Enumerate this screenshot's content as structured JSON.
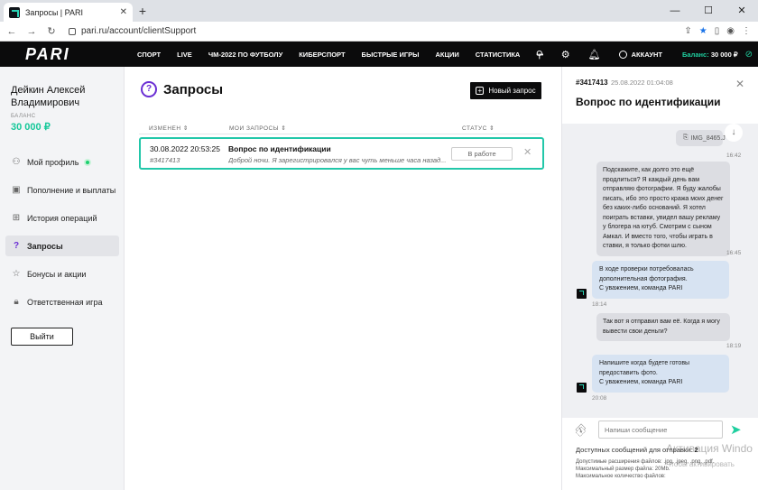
{
  "browser": {
    "tab_title": "Запросы | PARI",
    "url": "pari.ru/account/clientSupport"
  },
  "header": {
    "logo": "PARI",
    "nav": [
      "СПОРТ",
      "LIVE",
      "ЧМ-2022 ПО ФУТБОЛУ",
      "КИБЕРСПОРТ",
      "БЫСТРЫЕ ИГРЫ",
      "АКЦИИ",
      "СТАТИСТИКА",
      "•••"
    ],
    "account_label": "АККАУНТ",
    "balance_label": "Баланс:",
    "balance_value": "30 000 ₽"
  },
  "sidebar": {
    "user_name": "Дейкин Алексей Владимирович",
    "balance_label": "БАЛАНС",
    "balance_value": "30 000 ₽",
    "items": [
      {
        "label": "Мой профиль",
        "icon": "user-icon"
      },
      {
        "label": "Пополнение и выплаты",
        "icon": "wallet-icon"
      },
      {
        "label": "История операций",
        "icon": "grid-icon"
      },
      {
        "label": "Запросы",
        "icon": "question-icon"
      },
      {
        "label": "Бонусы и акции",
        "icon": "star-icon"
      },
      {
        "label": "Ответственная игра",
        "icon": "lock-icon"
      }
    ],
    "logout": "Выйти"
  },
  "main": {
    "title": "Запросы",
    "new_request": "Новый запрос",
    "columns": {
      "changed": "ИЗМЕНЕН",
      "my_requests": "МОИ ЗАПРОСЫ",
      "status": "СТАТУС"
    },
    "request": {
      "date": "30.08.2022 20:53:25",
      "id": "#3417413",
      "subject": "Вопрос по идентификации",
      "preview": "Доброй ночи. Я зарегистрировался у вас чуть меньше часа назад...",
      "status": "В работе"
    }
  },
  "chat": {
    "id": "#3417413",
    "datetime": "25.08.2022 01:04:08",
    "title": "Вопрос по идентификации",
    "attachment": "IMG_8465.J",
    "attachment_time": "16:42",
    "msg1": "Подскажите, как долго это ещё продлиться? Я каждый день вам отправляю фотографии. Я буду жалобы писать, ибо это просто кража моих денег без каких-либо оснований. Я хотел поиграть вставки, увидел вашу рекламу у блогера на ютуб. Смотрим с сыном Амкал. И вместо того, чтобы играть в ставки, я только фотки шлю.",
    "msg1_time": "16:45",
    "op1_line1": "В ходе проверки потребовалась дополнительная фотография.",
    "op1_line2": "С уважением, команда PARI",
    "op1_time": "18:14",
    "msg2": "Так вот я отправил вам её. Когда я могу вывести свои деньги?",
    "msg2_time": "18:19",
    "op2_line1": "Напишите когда будете готовы предоставить фото.",
    "op2_line2": "С уважением, команда PARI",
    "op2_time": "20:08",
    "input_placeholder": "Напиши сообщение",
    "available_label": "Доступных сообщений для отправки:",
    "available_count": "2",
    "rule1": "Допустимые расширения файлов: .jpg, .jpeg, .png, .pdf.",
    "rule2": "Максимальный размер файла: 20Mb.",
    "rule3": "Максимальное количество файлов:"
  },
  "watermark": {
    "line1": "Активация Windo",
    "line2": "Чтобы активировать"
  },
  "colors": {
    "accent_green": "#1fcf9f",
    "accent_purple": "#6b2fd4",
    "header_bg": "#0b0b0c"
  }
}
